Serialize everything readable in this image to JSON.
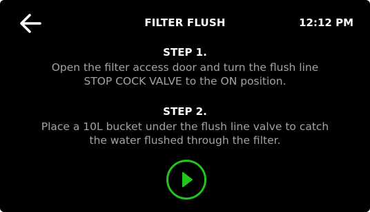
{
  "header": {
    "back_icon": "arrow-left-icon",
    "title": "FILTER FLUSH",
    "time": "12:12 PM"
  },
  "steps": [
    {
      "heading": "STEP 1.",
      "lines": [
        "Open the filter access door and turn the flush line",
        "STOP COCK VALVE to the ON position."
      ]
    },
    {
      "heading": "STEP 2.",
      "lines": [
        "Place a 10L bucket under the flush line valve to catch",
        "the water flushed through the filter."
      ]
    }
  ],
  "play_button": {
    "icon": "play-icon",
    "color": "#22c41e"
  },
  "colors": {
    "background": "#000000",
    "heading": "#ffffff",
    "body_text": "#a3a3a3",
    "accent": "#22c41e"
  }
}
